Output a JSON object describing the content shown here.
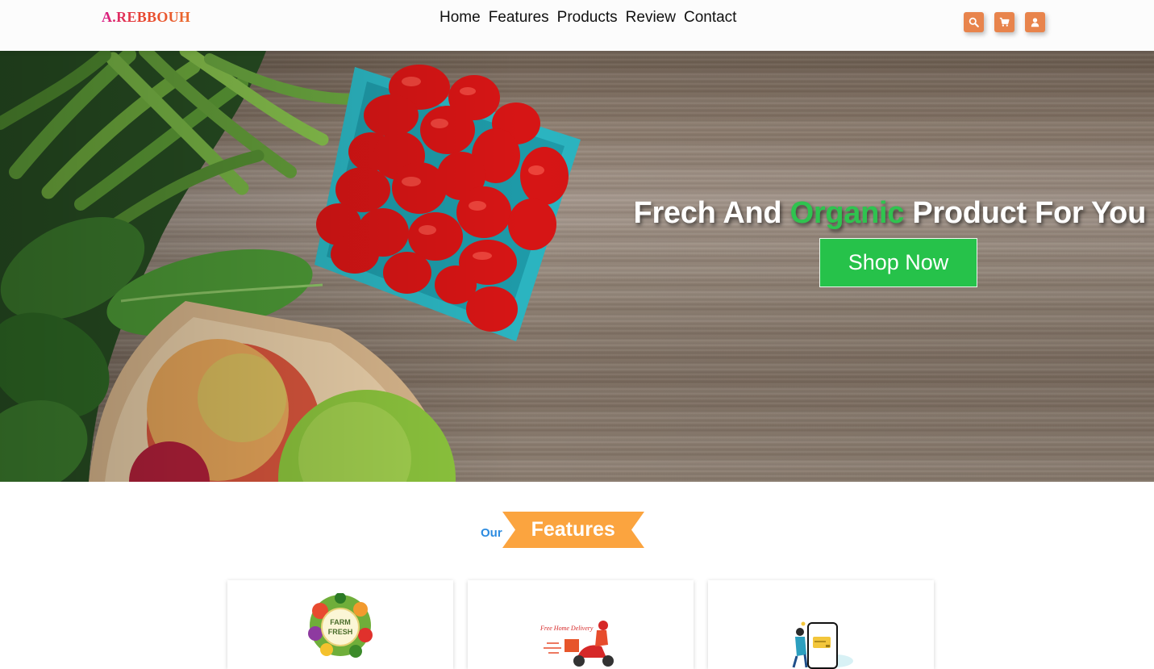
{
  "header": {
    "logo": "A.REBBOUH",
    "nav": [
      "Home",
      "Features",
      "Products",
      "Review",
      "Contact"
    ],
    "icons": [
      "search-icon",
      "cart-icon",
      "user-icon"
    ],
    "accent_color": "#e8844c"
  },
  "hero": {
    "title_part1": "Frech And ",
    "title_highlight": "Organic",
    "title_part2": " Product For You",
    "cta_label": "Shop Now",
    "highlight_color": "#2fc34f",
    "cta_color": "#26c24a"
  },
  "features": {
    "prefix": "Our",
    "title": "Features",
    "ribbon_color": "#fba43f",
    "cards": [
      {
        "image": "farm-fresh-badge",
        "badge_line1": "FARM",
        "badge_line2": "FRESH"
      },
      {
        "image": "delivery-scooter",
        "caption": "Free Home Delivery"
      },
      {
        "image": "mobile-payment"
      }
    ]
  }
}
